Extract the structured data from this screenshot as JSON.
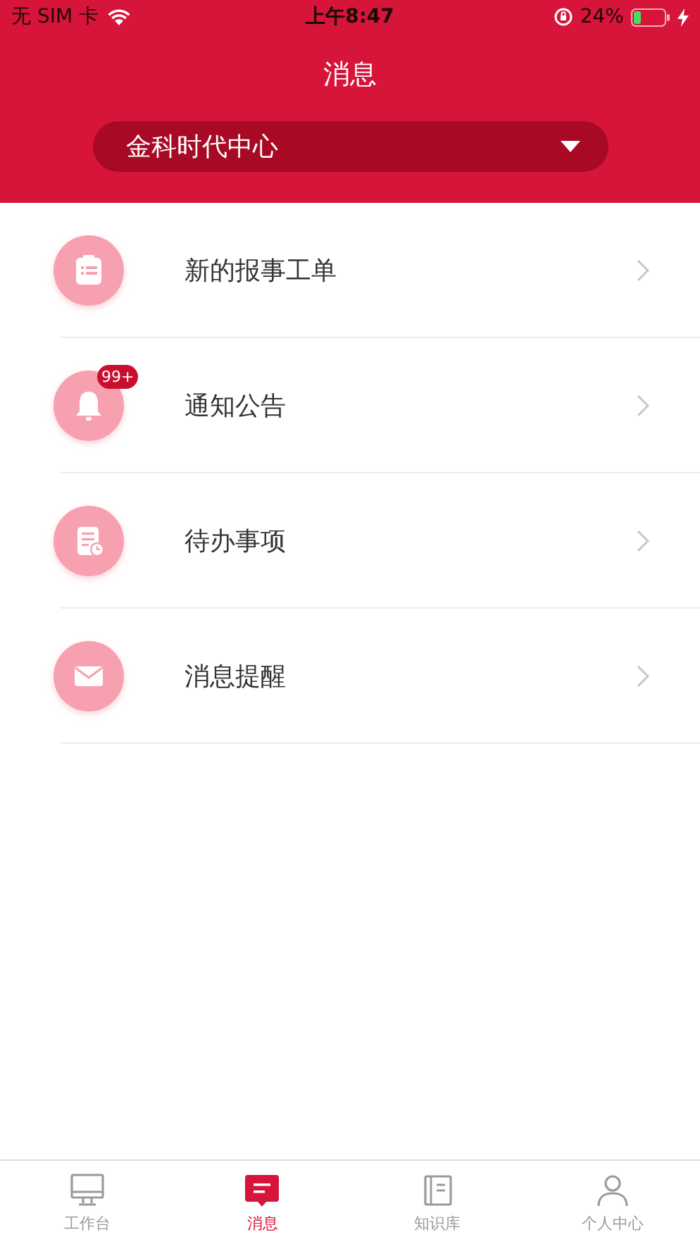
{
  "status_bar": {
    "carrier": "无 SIM 卡",
    "time": "上午8:47",
    "battery": "24%"
  },
  "header": {
    "title": "消息",
    "dropdown": {
      "value": "金科时代中心"
    }
  },
  "items": [
    {
      "kind": "clipboard",
      "label": "新的报事工单"
    },
    {
      "kind": "bell",
      "label": "通知公告",
      "badge": "99+"
    },
    {
      "kind": "todo",
      "label": "待办事项"
    },
    {
      "kind": "mail",
      "label": "消息提醒"
    }
  ],
  "tabs": [
    {
      "kind": "desktop",
      "label": "工作台",
      "selected": false
    },
    {
      "kind": "message",
      "label": "消息",
      "selected": true
    },
    {
      "kind": "book",
      "label": "知识库",
      "selected": false
    },
    {
      "kind": "person",
      "label": "个人中心",
      "selected": false
    }
  ]
}
